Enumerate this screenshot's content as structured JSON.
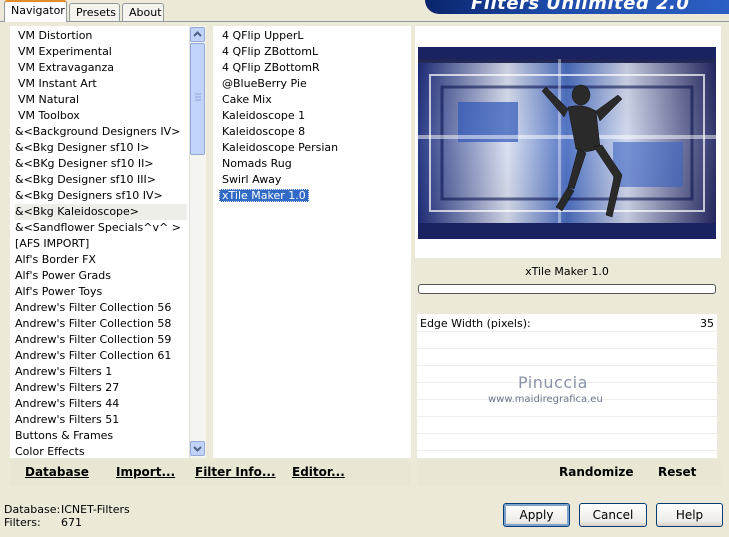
{
  "tabs": [
    {
      "label": "Navigator"
    },
    {
      "label": "Presets"
    },
    {
      "label": "About"
    }
  ],
  "banner": {
    "title": "Filters Unlimited 2.0"
  },
  "categories": [
    "VM Distortion",
    "VM Experimental",
    "VM Extravaganza",
    "VM Instant Art",
    "VM Natural",
    "VM Toolbox",
    "&<Background Designers IV>",
    "&<Bkg Designer sf10 I>",
    "&<BKg Designer sf10 II>",
    "&<Bkg Designer sf10 III>",
    "&<Bkg Designers sf10 IV>",
    "&<Bkg Kaleidoscope>",
    "&<Sandflower Specials^v^ >",
    "[AFS IMPORT]",
    "Alf's Border FX",
    "Alf's Power Grads",
    "Alf's Power Toys",
    "Andrew's Filter Collection 56",
    "Andrew's Filter Collection 58",
    "Andrew's Filter Collection 59",
    "Andrew's Filter Collection 61",
    "Andrew's Filters 1",
    "Andrew's Filters 27",
    "Andrew's Filters 44",
    "Andrew's Filters 51",
    "Buttons & Frames",
    "Color Effects"
  ],
  "selected_category": "&<Bkg Kaleidoscope>",
  "filters": [
    "4 QFlip UpperL",
    "4 QFlip ZBottomL",
    "4 QFlip ZBottomR",
    "@BlueBerry Pie",
    "Cake Mix",
    "Kaleidoscope 1",
    "Kaleidoscope 8",
    "Kaleidoscope Persian",
    "Nomads Rug",
    "Swirl Away",
    "xTile Maker 1.0"
  ],
  "selected_filter": "xTile Maker 1.0",
  "left_actions": {
    "database": "Database",
    "import": "Import...",
    "filter_info": "Filter Info...",
    "editor": "Editor..."
  },
  "preview": {
    "filter_name": "xTile Maker 1.0",
    "watermark_name": "Pinuccia",
    "watermark_url": "www.maidiregrafica.eu"
  },
  "params": [
    {
      "label": "Edge Width (pixels):",
      "value": "35"
    }
  ],
  "right_actions": {
    "randomize": "Randomize",
    "reset": "Reset"
  },
  "status": {
    "database_label": "Database:",
    "database_value": "ICNET-Filters",
    "filters_label": "Filters:",
    "filters_value": "671"
  },
  "buttons": {
    "apply": "Apply",
    "cancel": "Cancel",
    "help": "Help"
  },
  "colors": {
    "selection": "#316ac5",
    "background": "#ece9d8",
    "banner": "#1c4aa8"
  }
}
